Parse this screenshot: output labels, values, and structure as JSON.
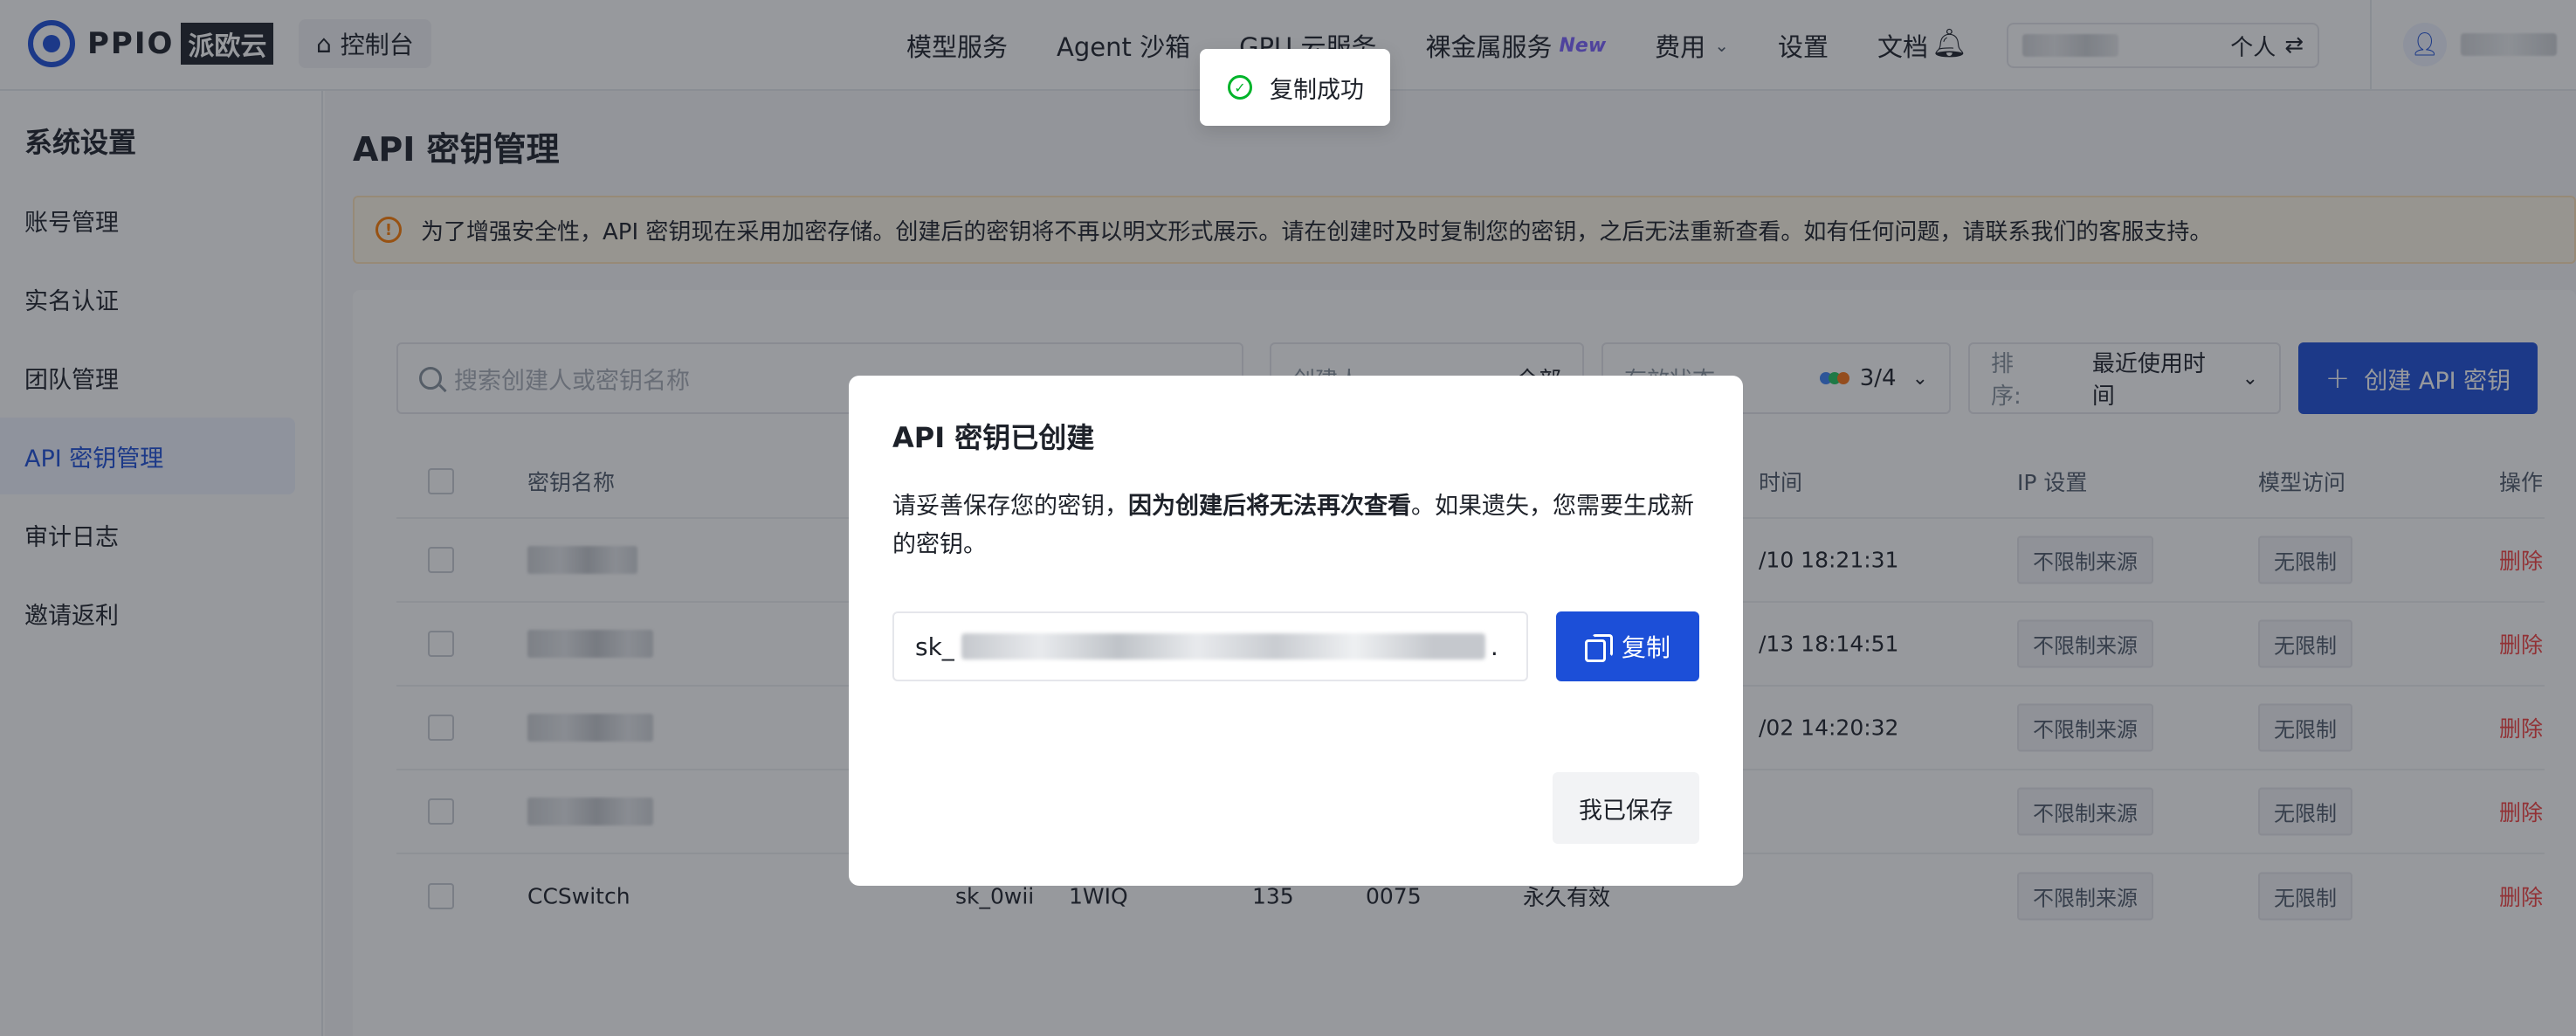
{
  "nav": {
    "logo_text": "PPIO",
    "logo_cn": "派欧云",
    "console": "控制台",
    "menu": [
      "模型服务",
      "Agent 沙箱",
      "GPU 云服务",
      "裸金属服务",
      "费用",
      "设置",
      "文档"
    ],
    "new_badge": "New",
    "personal": "个人"
  },
  "sidebar": {
    "title": "系统设置",
    "items": [
      "账号管理",
      "实名认证",
      "团队管理",
      "API 密钥管理",
      "审计日志",
      "邀请返利"
    ]
  },
  "page": {
    "title": "API 密钥管理",
    "alert": "为了增强安全性，API 密钥现在采用加密存储。创建后的密钥将不再以明文形式展示。请在创建时及时复制您的密钥，之后无法重新查看。如有任何问题，请联系我们的客服支持。"
  },
  "filters": {
    "search_placeholder": "搜索创建人或密钥名称",
    "creator_label": "创建人",
    "creator_value": "全部",
    "status_label": "有效状态",
    "status_count": "3/4",
    "sort_label": "排序:",
    "sort_value": "最近使用时间",
    "create_label": "创建 API 密钥"
  },
  "table": {
    "headers": {
      "name": "密钥名称",
      "time": "时间",
      "ip": "IP 设置",
      "model": "模型访问",
      "action": "操作"
    },
    "rows": [
      {
        "name": "",
        "time": "/10 18:21:31",
        "ip": "不限制来源",
        "model": "无限制",
        "action": "删除"
      },
      {
        "name": "",
        "time": "/13 18:14:51",
        "ip": "不限制来源",
        "model": "无限制",
        "action": "删除"
      },
      {
        "name": "",
        "time": "/02 14:20:32",
        "ip": "不限制来源",
        "model": "无限制",
        "action": "删除"
      },
      {
        "name": "",
        "time": "",
        "ip": "不限制来源",
        "model": "无限制",
        "action": "删除"
      },
      {
        "name": "CCSwitch",
        "key_partial": "sk_0wii",
        "key_partial2": "1WIQ",
        "n1": "135",
        "n2": "0075",
        "status": "永久有效",
        "time": "",
        "ip": "不限制来源",
        "model": "无限制",
        "action": "删除"
      }
    ]
  },
  "modal": {
    "title": "API 密钥已创建",
    "desc_before": "请妥善保存您的密钥，",
    "desc_bold": "因为创建后将无法再次查看",
    "desc_after": "。如果遗失，您需要生成新的密钥。",
    "key_prefix": "sk_",
    "key_suffix": ".",
    "copy": "复制",
    "saved": "我已保存"
  },
  "toast": {
    "text": "复制成功"
  },
  "colors": {
    "primary": "#1c4fd8",
    "danger": "#f53f3f",
    "warning": "#ff7d00",
    "success": "#00b42a"
  }
}
